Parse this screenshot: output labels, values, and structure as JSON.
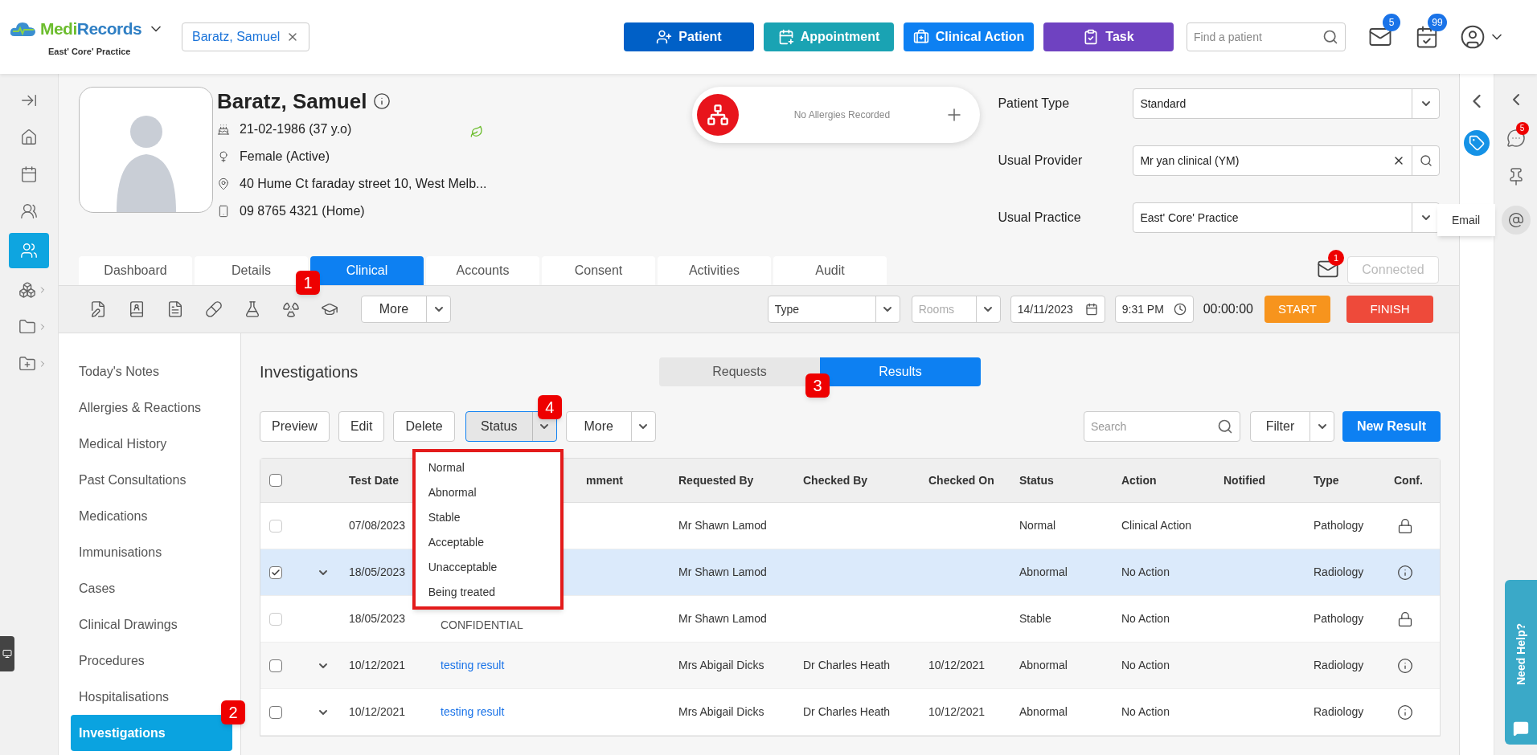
{
  "header": {
    "logo": [
      "Medi",
      "Records"
    ],
    "practice": "East' Core' Practice",
    "patient_tab": "Baratz, Samuel",
    "search": {
      "placeholder": "Find a patient"
    },
    "mail_count": "5",
    "task_count": "99",
    "actions": [
      {
        "label": "Patient",
        "color": "#0060c7",
        "kind": "patient"
      },
      {
        "label": "Appointment",
        "color": "#1aa3b3",
        "kind": "appointment"
      },
      {
        "label": "Clinical Action",
        "color": "#0d80f2",
        "kind": "clinical"
      },
      {
        "label": "Task",
        "color": "#6f42c1",
        "kind": "task"
      }
    ]
  },
  "patient": {
    "name": "Baratz, Samuel",
    "dob": "21-02-1986 (37 y.o)",
    "gender": "Female (Active)",
    "address": "40 Hume Ct faraday street 10, West Melb...",
    "phone": "09 8765 4321 (Home)",
    "allergies": "No Allergies Recorded"
  },
  "fields": [
    {
      "label": "Patient Type",
      "value": "Standard",
      "kind": "select"
    },
    {
      "label": "Usual Provider",
      "value": "Mr yan clinical (YM)",
      "kind": "search"
    },
    {
      "label": "Usual Practice",
      "value": "East' Core' Practice",
      "kind": "select"
    }
  ],
  "tabs": [
    {
      "label": "Dashboard",
      "selected": false
    },
    {
      "label": "Details",
      "selected": false
    },
    {
      "label": "Clinical",
      "selected": true
    },
    {
      "label": "Accounts",
      "selected": false
    },
    {
      "label": "Consent",
      "selected": false
    },
    {
      "label": "Activities",
      "selected": false
    },
    {
      "label": "Audit",
      "selected": false
    }
  ],
  "message_count": "1",
  "connected": {
    "label": "Connected",
    "disabled": true
  },
  "toolbar": {
    "more": "More",
    "type": "Type",
    "rooms": "Rooms",
    "date": "14/11/2023",
    "time": "9:31 PM",
    "timer": "00:00:00",
    "start": "START",
    "finish": "FINISH"
  },
  "menu": [
    {
      "label": "Today's Notes",
      "selected": false
    },
    {
      "label": "Allergies & Reactions",
      "selected": false
    },
    {
      "label": "Medical History",
      "selected": false
    },
    {
      "label": "Past Consultations",
      "selected": false
    },
    {
      "label": "Medications",
      "selected": false
    },
    {
      "label": "Immunisations",
      "selected": false
    },
    {
      "label": "Cases",
      "selected": false
    },
    {
      "label": "Clinical Drawings",
      "selected": false
    },
    {
      "label": "Procedures",
      "selected": false
    },
    {
      "label": "Hospitalisations",
      "selected": false
    },
    {
      "label": "Investigations",
      "selected": true
    }
  ],
  "section_title": "Investigations",
  "views": [
    {
      "label": "Requests",
      "selected": false
    },
    {
      "label": "Results",
      "selected": true
    }
  ],
  "buttons": [
    "Preview",
    "Edit",
    "Delete"
  ],
  "status_button": "Status",
  "more_button": "More",
  "search": {
    "placeholder": "Search"
  },
  "filter": "Filter",
  "new_result": "New Result",
  "status_menu": [
    "Normal",
    "Abnormal",
    "Stable",
    "Acceptable",
    "Unacceptable",
    "Being treated"
  ],
  "select_all": {
    "checked": false
  },
  "columns": [
    "Test Date",
    "mment",
    "Requested By",
    "Checked By",
    "Checked On",
    "Status",
    "Action",
    "Notified",
    "Type",
    "Conf."
  ],
  "rows": [
    {
      "checked": false,
      "disabled": true,
      "expandable": false,
      "date": "07/08/2023",
      "requested_by": "Mr Shawn Lamod",
      "status": "Normal",
      "action": "Clinical Action",
      "type": "Pathology",
      "locked": true
    },
    {
      "checked": true,
      "disabled": false,
      "expandable": true,
      "date": "18/05/2023",
      "requested_by": "Mr Shawn Lamod",
      "status": "Abnormal",
      "action": "No Action",
      "type": "Radiology",
      "locked": false
    },
    {
      "checked": false,
      "disabled": true,
      "expandable": false,
      "date": "18/05/2023",
      "name": {
        "text": "CONFIDENTIAL",
        "link": false
      },
      "requested_by": "Mr Shawn Lamod",
      "status": "Stable",
      "action": "No Action",
      "type": "Pathology",
      "locked": true
    },
    {
      "checked": false,
      "disabled": false,
      "expandable": true,
      "date": "10/12/2021",
      "name": {
        "text": "testing result",
        "link": true
      },
      "requested_by": "Mrs Abigail Dicks",
      "checked_by": "Dr Charles Heath",
      "checked_on": "10/12/2021",
      "status": "Abnormal",
      "action": "No Action",
      "type": "Radiology",
      "locked": false
    },
    {
      "checked": false,
      "disabled": false,
      "expandable": true,
      "date": "10/12/2021",
      "name": {
        "text": "testing result",
        "link": true
      },
      "requested_by": "Mrs Abigail Dicks",
      "checked_by": "Dr Charles Heath",
      "checked_on": "10/12/2021",
      "status": "Abnormal",
      "action": "No Action",
      "type": "Radiology",
      "locked": false
    }
  ],
  "callouts": [
    "1",
    "2",
    "3",
    "4"
  ],
  "side": {
    "tooltip": "Email",
    "chat_count": "5",
    "help": "Need Help?"
  }
}
